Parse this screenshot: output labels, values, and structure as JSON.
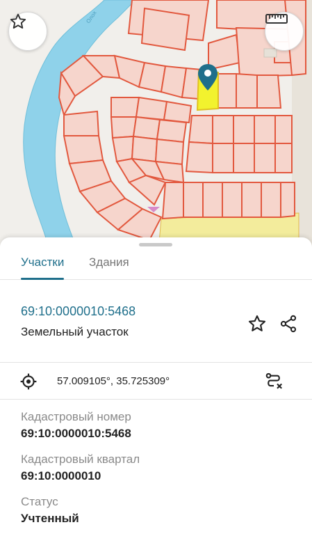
{
  "map": {
    "street_label": "Олох"
  },
  "colors": {
    "accent": "#1f6f8b",
    "parcel_stroke": "#e2583e",
    "parcel_fill": "#f6d5cc",
    "selected_fill": "#f2f22e",
    "river": "#8fd2ea",
    "marker": "#1f6f8b"
  },
  "tabs": [
    {
      "label": "Участки",
      "active": true
    },
    {
      "label": "Здания",
      "active": false
    }
  ],
  "parcel": {
    "number": "69:10:0000010:5468",
    "type": "Земельный участок"
  },
  "coordinates": "57.009105°, 35.725309°",
  "details": [
    {
      "label": "Кадастровый номер",
      "value": "69:10:0000010:5468"
    },
    {
      "label": "Кадастровый квартал",
      "value": "69:10:0000010"
    },
    {
      "label": "Статус",
      "value": "Учтенный"
    }
  ],
  "icons": {
    "map_favorite": "star-outline-icon",
    "ruler": "ruler-icon",
    "favorite": "star-outline-icon",
    "share": "share-icon",
    "location": "target-icon",
    "route": "route-clear-icon",
    "marker": "map-pin-icon"
  }
}
